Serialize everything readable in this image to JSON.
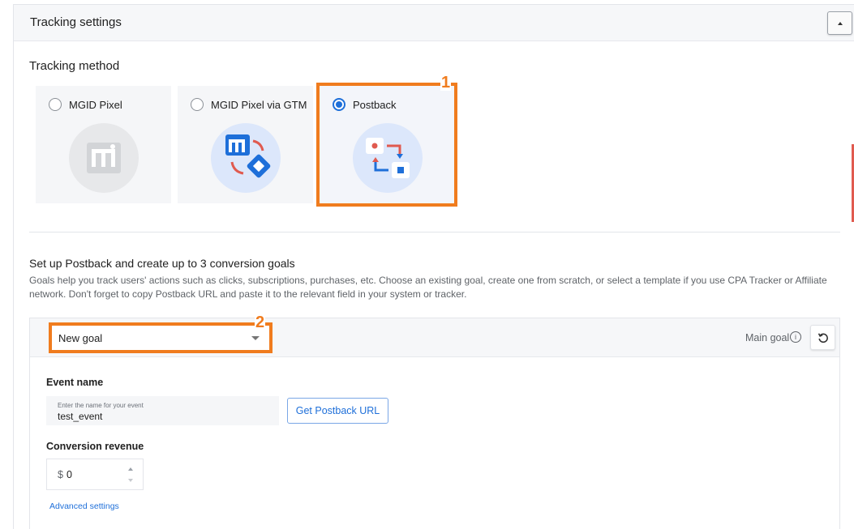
{
  "panel": {
    "title": "Tracking settings"
  },
  "tracking": {
    "title": "Tracking method",
    "options": [
      {
        "label": "MGID Pixel",
        "selected": false,
        "icon": "mgid-logo-icon"
      },
      {
        "label": "MGID Pixel via GTM",
        "selected": false,
        "icon": "mgid-gtm-icon"
      },
      {
        "label": "Postback",
        "selected": true,
        "icon": "postback-arrows-icon"
      }
    ]
  },
  "postback": {
    "title": "Set up Postback and create up to 3 conversion goals",
    "description": "Goals help you track users' actions such as clicks, subscriptions, purchases, etc. Choose an existing goal, create one from scratch, or select a template if you use CPA Tracker or Affiliate network. Don't forget to copy Postback URL and paste it to the relevant field in your system or tracker.",
    "goal_select": "New goal",
    "main_goal_label": "Main goal",
    "event_name_label": "Event name",
    "event_name_placeholder": "Enter the name for your event",
    "event_name_value": "test_event",
    "get_url_button": "Get Postback URL",
    "revenue_label": "Conversion revenue",
    "currency": "$",
    "revenue_value": "0",
    "advanced_link": "Advanced settings"
  },
  "annotations": {
    "one": "1",
    "two": "2"
  },
  "colors": {
    "accent": "#1e6fd9",
    "highlight": "#f07c1e"
  }
}
